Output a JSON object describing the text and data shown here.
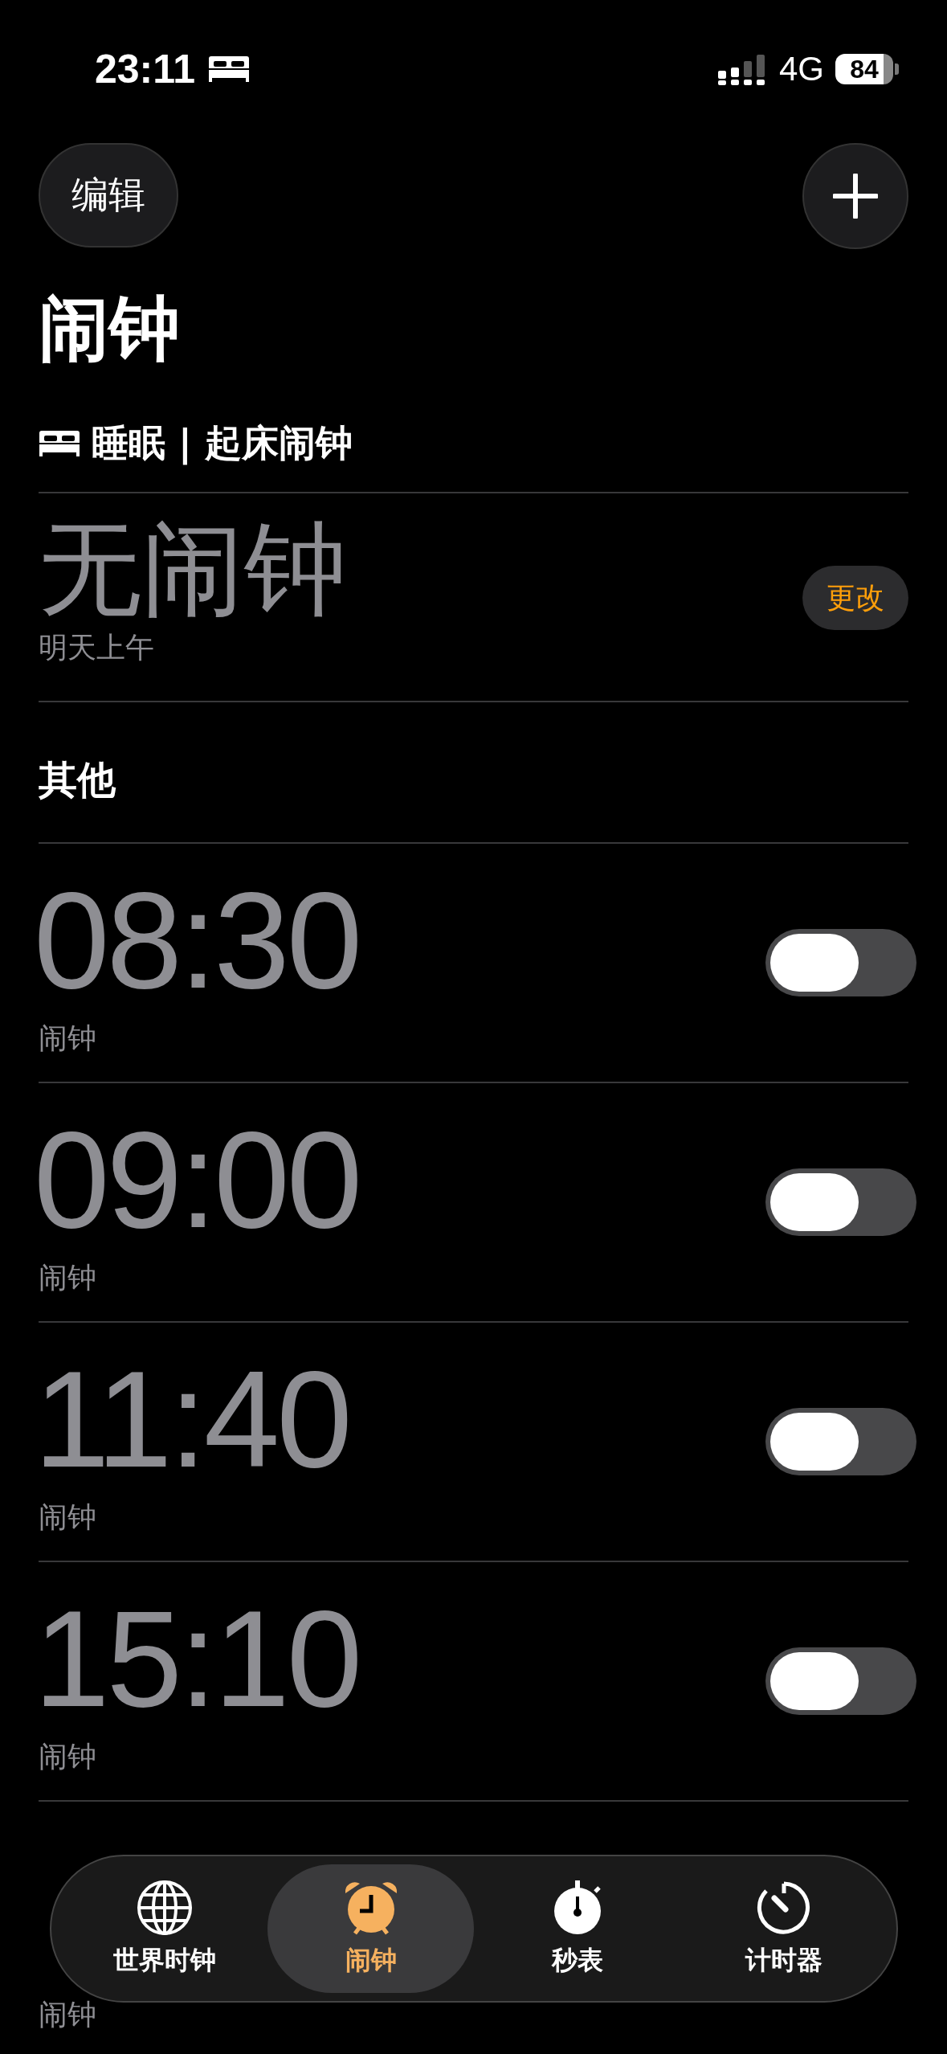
{
  "status_bar": {
    "time": "23:11",
    "network": "4G",
    "battery": "84"
  },
  "edit_button": "编辑",
  "title": "闹钟",
  "sleep_section": {
    "title": "睡眠 | 起床闹钟",
    "alarm": "无闹钟",
    "subtitle": "明天上午",
    "change_button": "更改"
  },
  "other_section": {
    "title": "其他",
    "alarms": [
      {
        "time": "08:30",
        "label": "闹钟",
        "on": false
      },
      {
        "time": "09:00",
        "label": "闹钟",
        "on": false
      },
      {
        "time": "11:40",
        "label": "闹钟",
        "on": false
      },
      {
        "time": "15:10",
        "label": "闹钟",
        "on": false
      },
      {
        "label": "闹钟"
      }
    ]
  },
  "tab_bar": {
    "tabs": [
      {
        "label": "世界时钟",
        "selected": false
      },
      {
        "label": "闹钟",
        "selected": true
      },
      {
        "label": "秒表",
        "selected": false
      },
      {
        "label": "计时器",
        "selected": false
      }
    ]
  }
}
